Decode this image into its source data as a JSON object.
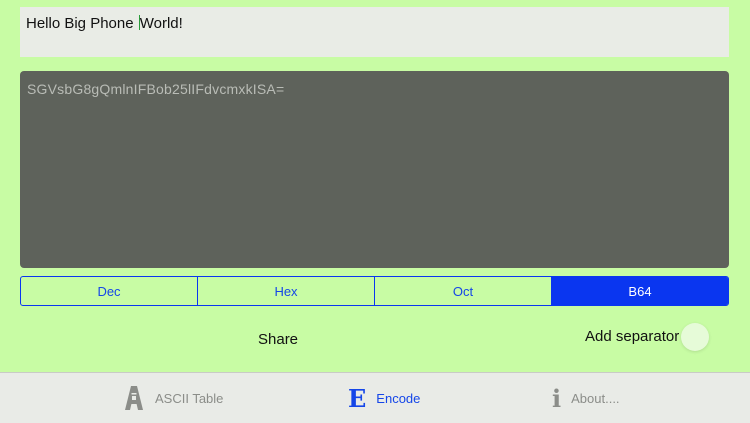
{
  "input": {
    "text_before_caret": "Hello Big Phone ",
    "text_after_caret": "World!"
  },
  "output": {
    "text": "SGVsbG8gQmlnIFBob25lIFdvcmxkISA="
  },
  "formats": [
    {
      "label": "Dec",
      "selected": false
    },
    {
      "label": "Hex",
      "selected": false
    },
    {
      "label": "Oct",
      "selected": false
    },
    {
      "label": "B64",
      "selected": true
    }
  ],
  "actions": {
    "share_label": "Share",
    "separator_label": "Add separator",
    "separator_on": false
  },
  "tabs": [
    {
      "label": "ASCII Table",
      "icon": "ascii-a-icon",
      "active": false
    },
    {
      "label": "Encode",
      "icon": "encode-e-icon",
      "active": true
    },
    {
      "label": "About....",
      "icon": "info-i-icon",
      "active": false
    }
  ],
  "colors": {
    "background": "#c8fca4",
    "accent": "#0a36f0",
    "output_bg": "#5e625b"
  }
}
